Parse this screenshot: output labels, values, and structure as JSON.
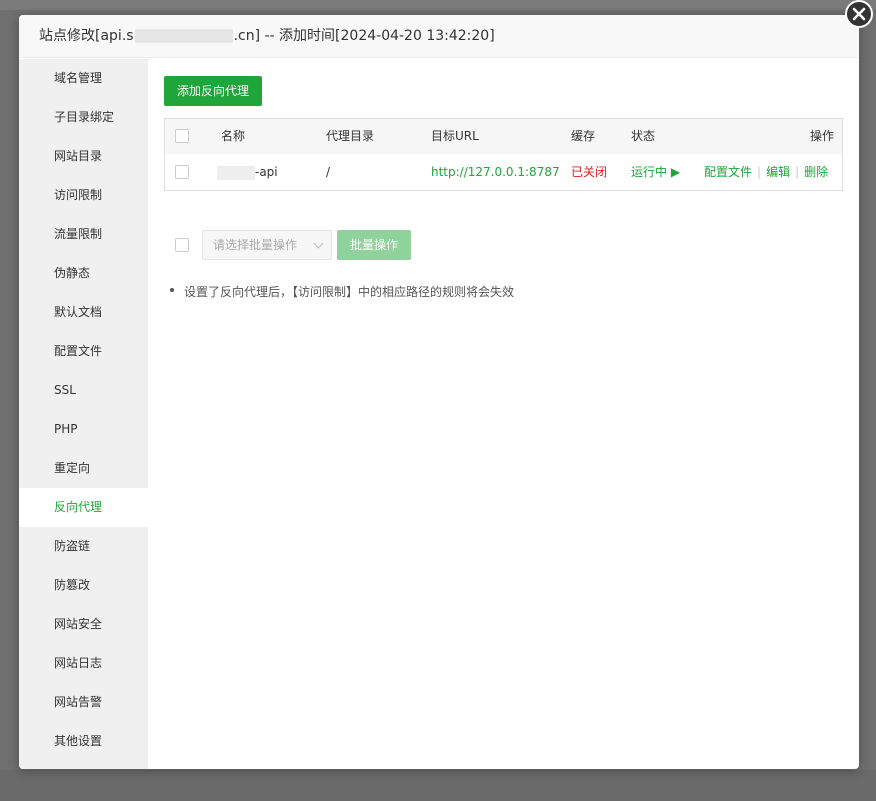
{
  "dialog": {
    "title_prefix": "站点修改[api.s",
    "title_suffix": ".cn] -- 添加时间[2024-04-20 13:42:20]"
  },
  "sidebar": {
    "items": [
      {
        "label": "域名管理"
      },
      {
        "label": "子目录绑定"
      },
      {
        "label": "网站目录"
      },
      {
        "label": "访问限制"
      },
      {
        "label": "流量限制"
      },
      {
        "label": "伪静态"
      },
      {
        "label": "默认文档"
      },
      {
        "label": "配置文件"
      },
      {
        "label": "SSL"
      },
      {
        "label": "PHP"
      },
      {
        "label": "重定向"
      },
      {
        "label": "反向代理"
      },
      {
        "label": "防盗链"
      },
      {
        "label": "防篡改"
      },
      {
        "label": "网站安全"
      },
      {
        "label": "网站日志"
      },
      {
        "label": "网站告警"
      },
      {
        "label": "其他设置"
      }
    ],
    "active": "反向代理"
  },
  "main": {
    "add_button": "添加反向代理",
    "table": {
      "headers": {
        "name": "名称",
        "dir": "代理目录",
        "url": "目标URL",
        "cache": "缓存",
        "status": "状态",
        "ops": "操作"
      },
      "rows": [
        {
          "name_suffix": "-api",
          "dir": "/",
          "url": "http://127.0.0.1:8787",
          "cache": "已关闭",
          "status": "运行中",
          "status_icon": "▶",
          "op_config": "配置文件",
          "op_edit": "编辑",
          "op_delete": "删除",
          "op_sep": "|"
        }
      ]
    },
    "batch": {
      "placeholder": "请选择批量操作",
      "button": "批量操作"
    },
    "tip": "设置了反向代理后，【访问限制】中的相应路径的规则将会失效"
  },
  "colors": {
    "accent": "#20a53a",
    "danger": "#e02020"
  }
}
